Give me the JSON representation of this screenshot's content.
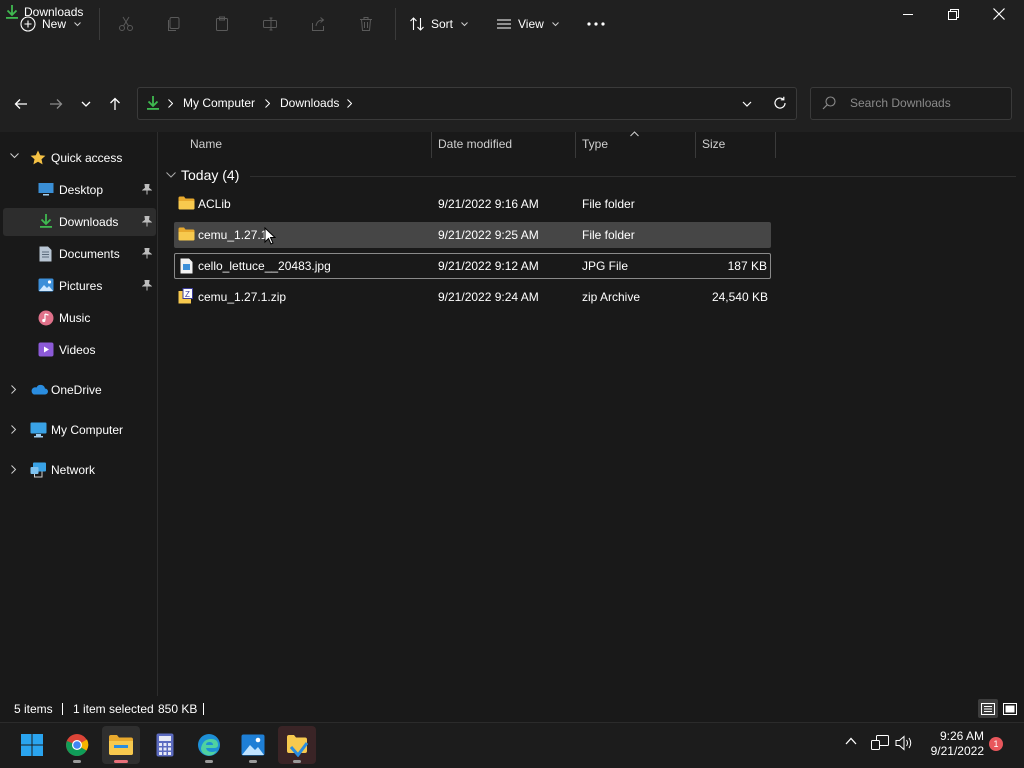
{
  "window": {
    "title": "Downloads"
  },
  "toolbar": {
    "new_label": "New",
    "sort_label": "Sort",
    "view_label": "View"
  },
  "address": {
    "segments": [
      "My Computer",
      "Downloads"
    ],
    "search_placeholder": "Search Downloads"
  },
  "sidebar": {
    "quick_access": "Quick access",
    "items": [
      {
        "label": "Desktop",
        "icon": "desktop-icon",
        "pinned": true
      },
      {
        "label": "Downloads",
        "icon": "download-icon",
        "pinned": true,
        "selected": true
      },
      {
        "label": "Documents",
        "icon": "documents-icon",
        "pinned": true
      },
      {
        "label": "Pictures",
        "icon": "pictures-icon",
        "pinned": true
      },
      {
        "label": "Music",
        "icon": "music-icon",
        "pinned": false
      },
      {
        "label": "Videos",
        "icon": "videos-icon",
        "pinned": false
      }
    ],
    "roots": [
      {
        "label": "OneDrive",
        "icon": "onedrive-icon"
      },
      {
        "label": "My Computer",
        "icon": "computer-icon"
      },
      {
        "label": "Network",
        "icon": "network-icon"
      }
    ]
  },
  "columns": [
    "Name",
    "Date modified",
    "Type",
    "Size"
  ],
  "group": {
    "label": "Today (4)"
  },
  "files": [
    {
      "name": "ACLib",
      "date": "9/21/2022 9:16 AM",
      "type": "File folder",
      "size": "",
      "icon": "folder-icon"
    },
    {
      "name": "cemu_1.27.1",
      "date": "9/21/2022 9:25 AM",
      "type": "File folder",
      "size": "",
      "icon": "folder-icon",
      "selected": true
    },
    {
      "name": "cello_lettuce__20483.jpg",
      "date": "9/21/2022 9:12 AM",
      "type": "JPG File",
      "size": "187 KB",
      "icon": "image-file-icon",
      "focused": true
    },
    {
      "name": "cemu_1.27.1.zip",
      "date": "9/21/2022 9:24 AM",
      "type": "zip Archive",
      "size": "24,540 KB",
      "icon": "zip-icon"
    }
  ],
  "status": {
    "items": "5 items",
    "selected": "1 item selected",
    "size": "850 KB"
  },
  "taskbar": {
    "time": "9:26 AM",
    "date": "9/21/2022",
    "notifications": "1"
  },
  "colors": {
    "accent": "#4cc2ff",
    "folder": "#f5c144",
    "download_green": "#3fb950",
    "selection": "#464646"
  }
}
